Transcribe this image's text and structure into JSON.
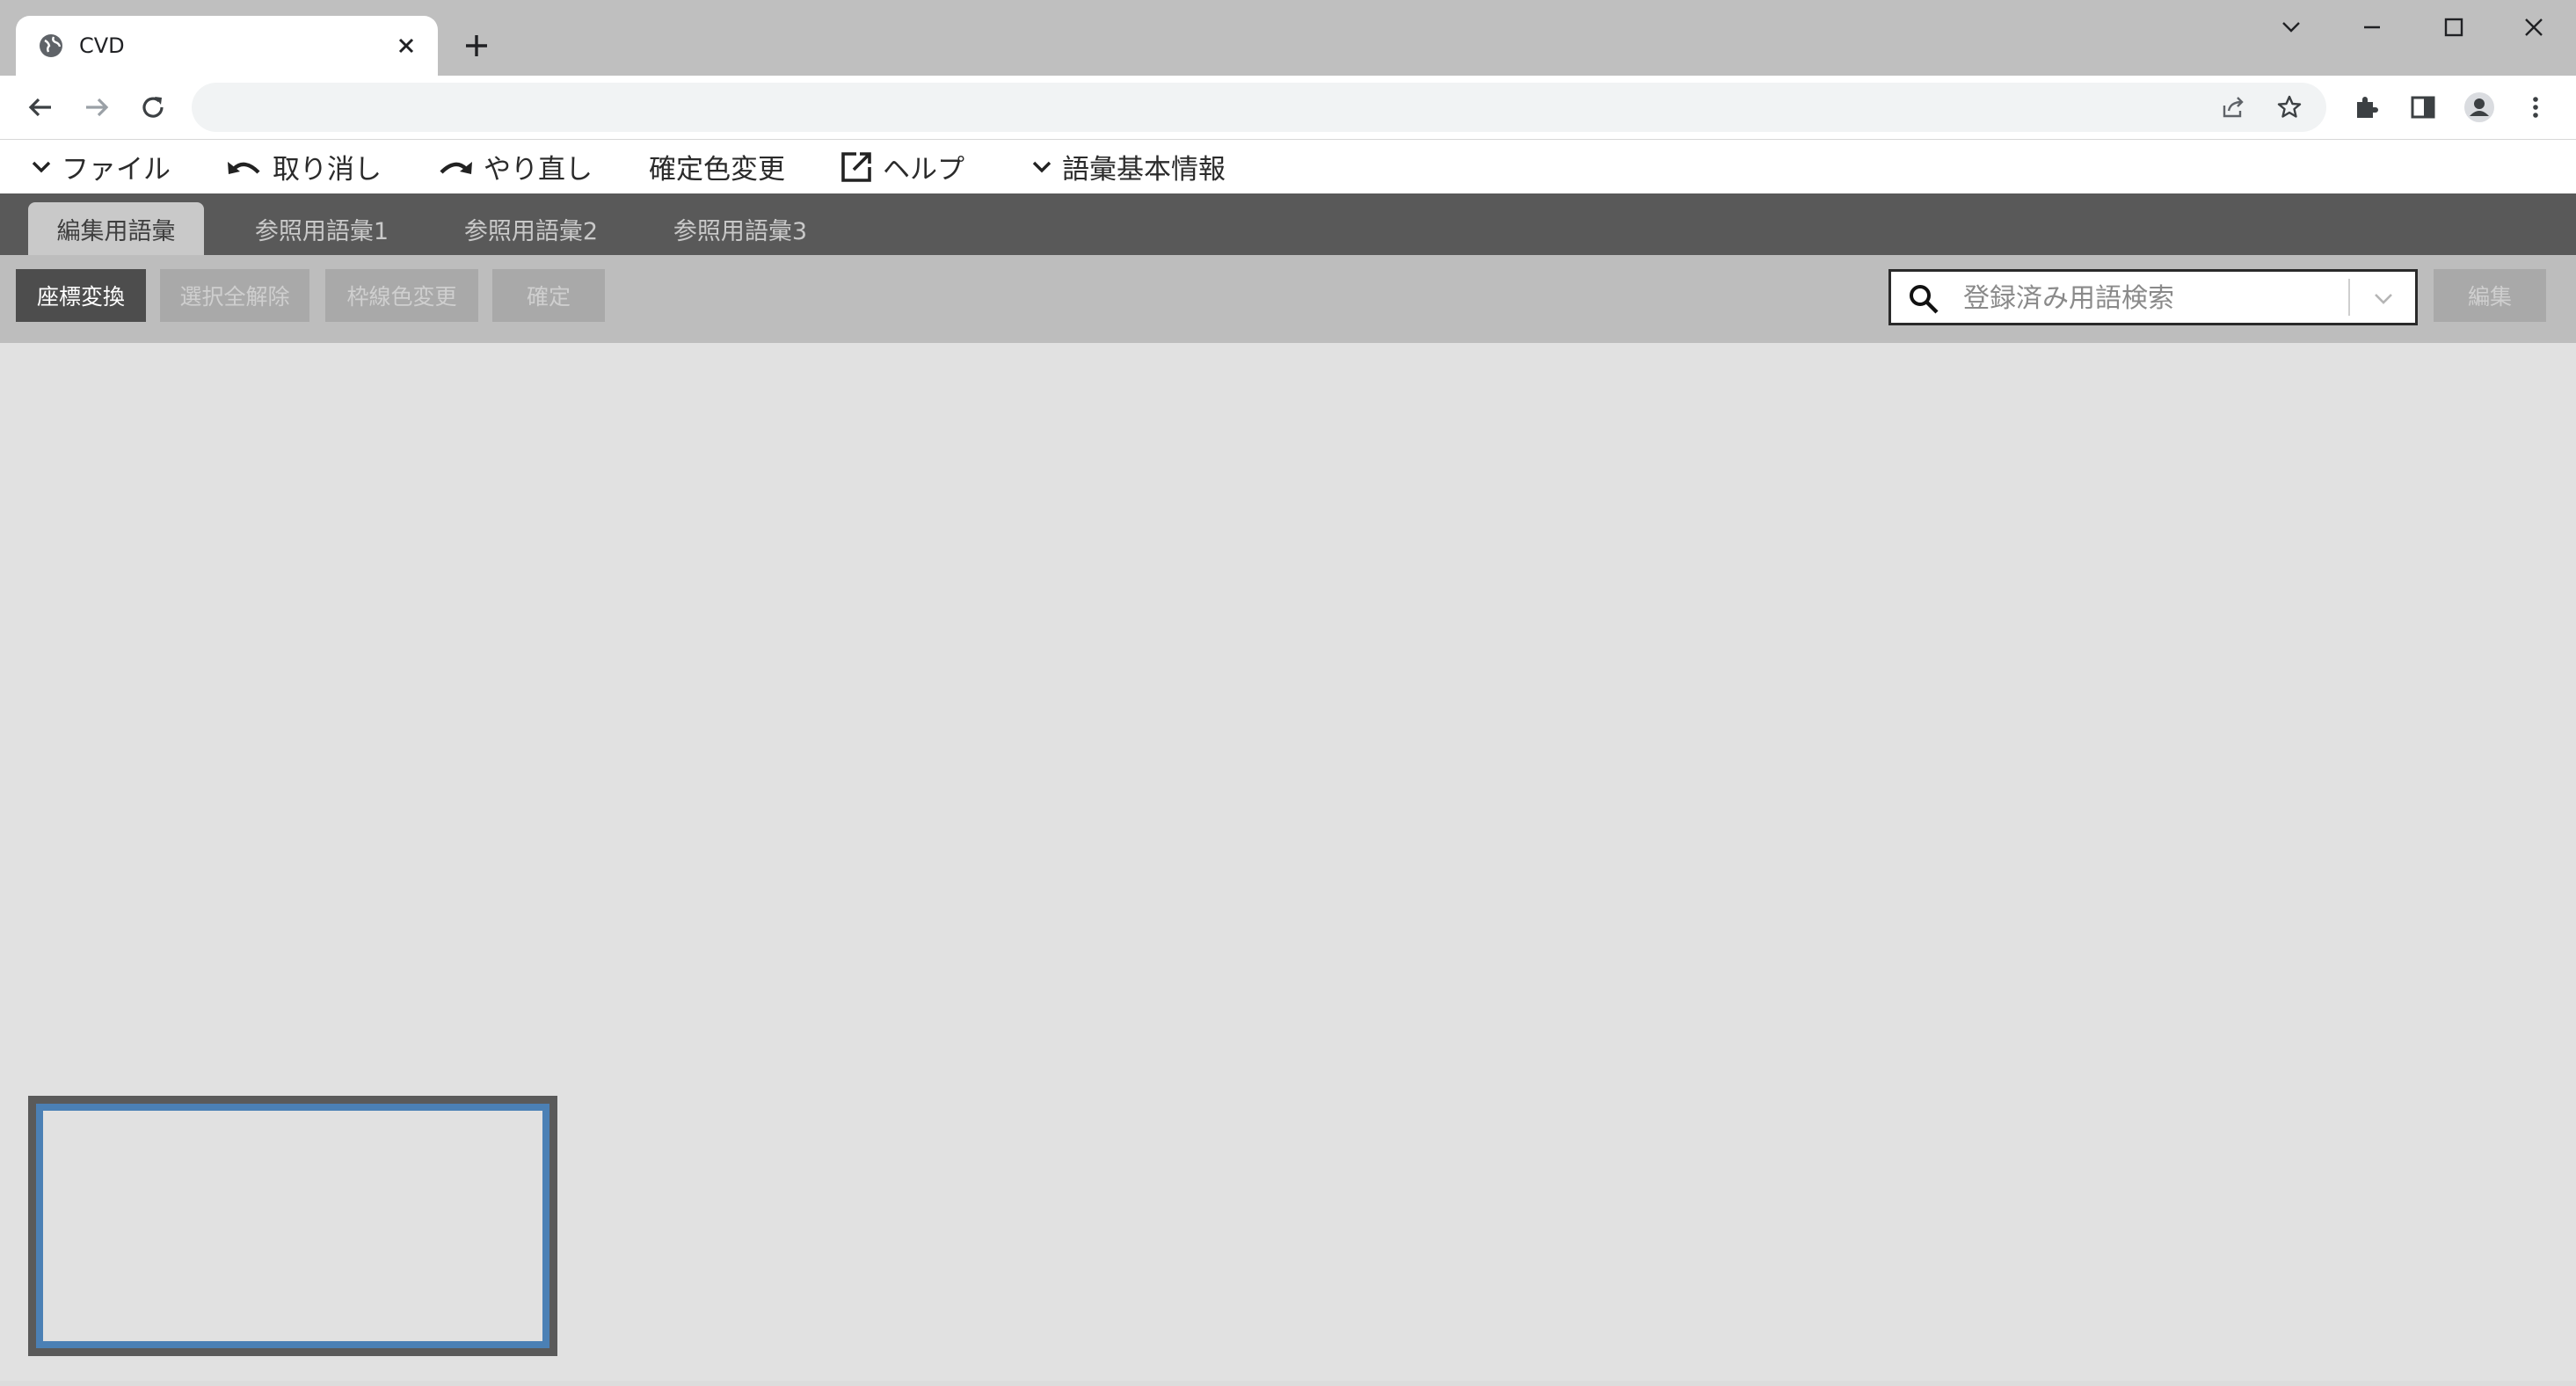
{
  "browser": {
    "tab_title": "CVD",
    "tab_icons": {
      "favicon": "globe-icon",
      "close": "close-icon",
      "new_tab": "plus-icon"
    },
    "window_controls": [
      "chevron-down-icon",
      "minimize-icon",
      "maximize-icon",
      "close-icon"
    ],
    "address_value": "",
    "toolbar_icons": [
      "share-icon",
      "star-icon",
      "puzzle-icon",
      "sidepanel-icon",
      "profile-icon",
      "kebab-icon"
    ]
  },
  "menu": {
    "file": "ファイル",
    "undo": "取り消し",
    "redo": "やり直し",
    "confirm_color": "確定色変更",
    "help": "ヘルプ",
    "vocab_info": "語彙基本情報"
  },
  "vocab_tabs": [
    {
      "label": "編集用語彙",
      "active": true
    },
    {
      "label": "参照用語彙1",
      "active": false
    },
    {
      "label": "参照用語彙2",
      "active": false
    },
    {
      "label": "参照用語彙3",
      "active": false
    }
  ],
  "actions": {
    "coordinate_transform": "座標変換",
    "deselect_all": "選択全解除",
    "border_color_change": "枠線色変更",
    "confirm": "確定",
    "edit": "編集"
  },
  "search": {
    "placeholder": "登録済み用語検索",
    "value": ""
  },
  "colors": {
    "accent_minimap": "#4b80b5",
    "primary_button": "#4d4d4d",
    "tab_bar": "#595959"
  }
}
